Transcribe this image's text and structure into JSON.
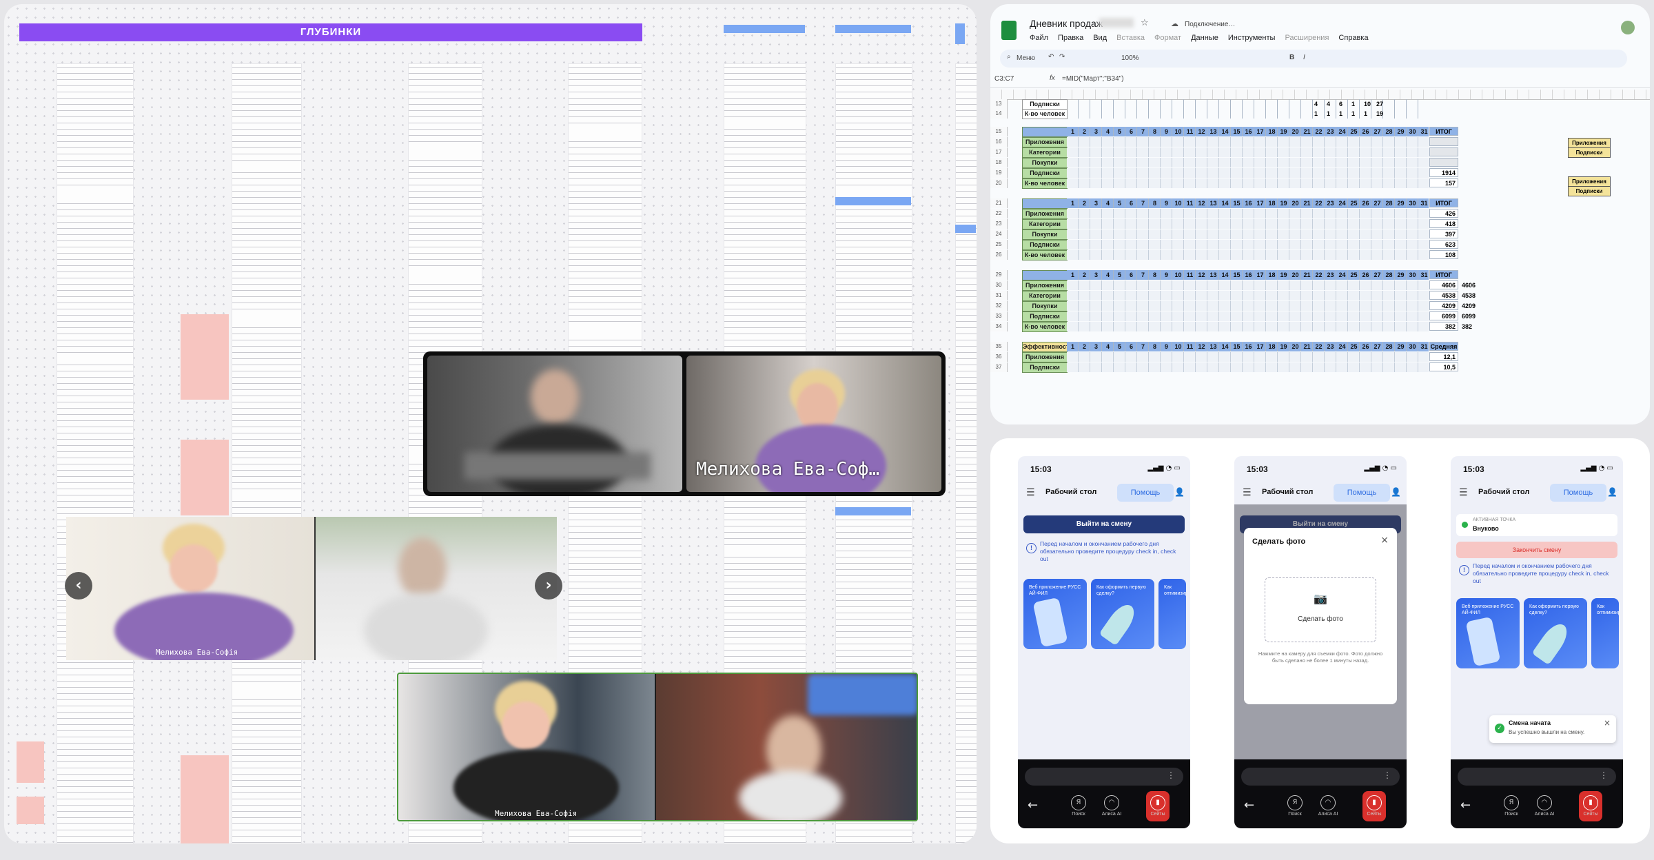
{
  "board": {
    "header_title": "ГЛУБИНКИ",
    "prev_icon": "chevron-left-icon",
    "next_icon": "chevron-right-icon",
    "call_participants": [
      {
        "name": "Мелихова Ева-Соф…"
      },
      {
        "name": "Мелихова Ева-Софія"
      },
      {
        "name": "Мелихова Ева-Софія"
      }
    ]
  },
  "sheet": {
    "doc_title": "Дневник продаж",
    "status": "Подключение…",
    "menu": [
      "Файл",
      "Правка",
      "Вид",
      "Вставка",
      "Формат",
      "Данные",
      "Инструменты",
      "Расширения",
      "Справка"
    ],
    "toolbar": {
      "menu_label": "Меню",
      "zoom": "100%"
    },
    "name_box": "C3:C7",
    "formula": "=MID(\"Март\";\"B34\")",
    "top_rows": [
      {
        "row": "13",
        "label": "Подписки",
        "values": [
          "4",
          "4",
          "6",
          "1",
          "10",
          "27"
        ]
      },
      {
        "row": "14",
        "label": "К-во человек",
        "values": [
          "1",
          "1",
          "1",
          "1",
          "1",
          "19"
        ]
      }
    ],
    "sections": [
      {
        "header_row": "15",
        "header_label": "",
        "rows": [
          {
            "row": "16",
            "label": "Приложения",
            "total": ""
          },
          {
            "row": "17",
            "label": "Категории",
            "total": ""
          },
          {
            "row": "18",
            "label": "Покупки",
            "total": ""
          },
          {
            "row": "19",
            "label": "Подписки",
            "total": "1914"
          },
          {
            "row": "20",
            "label": "К-во человек",
            "total": "157"
          }
        ]
      },
      {
        "header_row": "21",
        "header_label": "",
        "rows": [
          {
            "row": "22",
            "label": "Приложения",
            "total": "426"
          },
          {
            "row": "23",
            "label": "Категории",
            "total": "418"
          },
          {
            "row": "24",
            "label": "Покупки",
            "total": "397"
          },
          {
            "row": "25",
            "label": "Подписки",
            "total": "623"
          },
          {
            "row": "26",
            "label": "К-во человек",
            "total": "108"
          }
        ]
      },
      {
        "header_row": "29",
        "header_label": "",
        "rows": [
          {
            "row": "30",
            "label": "Приложения",
            "total": "4606",
            "extra": "4606"
          },
          {
            "row": "31",
            "label": "Категории",
            "total": "4538",
            "extra": "4538"
          },
          {
            "row": "32",
            "label": "Покупки",
            "total": "4209",
            "extra": "4209"
          },
          {
            "row": "33",
            "label": "Подписки",
            "total": "6099",
            "extra": "6099"
          },
          {
            "row": "34",
            "label": "К-во человек",
            "total": "382",
            "extra": "382"
          }
        ]
      },
      {
        "header_row": "35",
        "header_label": "Эффективность",
        "rows": [
          {
            "row": "36",
            "label": "Приложения",
            "total": "12,1"
          },
          {
            "row": "37",
            "label": "Подписки",
            "total": "10,5"
          }
        ]
      }
    ],
    "total_label": "ИТОГ",
    "avg_label": "Средняя",
    "days": [
      "1",
      "2",
      "3",
      "4",
      "5",
      "6",
      "7",
      "8",
      "9",
      "10",
      "11",
      "12",
      "13",
      "14",
      "15",
      "16",
      "17",
      "18",
      "19",
      "20",
      "21",
      "22",
      "23",
      "24",
      "25",
      "26",
      "27",
      "28",
      "29",
      "30",
      "31"
    ],
    "side_labels": [
      "Приложения",
      "Подписки",
      "Приложения",
      "Подписки"
    ]
  },
  "phones": {
    "time": "15:03",
    "header_title": "Рабочий стол",
    "help_label": "Помощь",
    "shift_button": "Выйти на смену",
    "checkin_info": "Перед началом и окончанием рабочего дня обязательно проведите процедуру check in, check out",
    "cards": [
      {
        "label": "Веб приложение РУСС АЙ-ФИЛ"
      },
      {
        "label": "Как оформить первую сделку?"
      },
      {
        "label": "Как оптимизировать"
      }
    ],
    "nav": [
      "Поиск",
      "Алиса AI",
      "Сейты"
    ],
    "modal": {
      "title": "Сделать фото",
      "close": "×",
      "photo_label": "Сделать фото",
      "hint": "Нажмите на камеру для съемки фото. Фото должно быть сделано не более 1 минуты назад."
    },
    "active_point_label": "АКТИВНАЯ ТОЧКА",
    "active_point_value": "Внуково",
    "end_shift_button": "Закончить смену",
    "toast": {
      "title": "Смена начата",
      "subtitle": "Вы успешно вышли на смену.",
      "close": "×"
    }
  }
}
